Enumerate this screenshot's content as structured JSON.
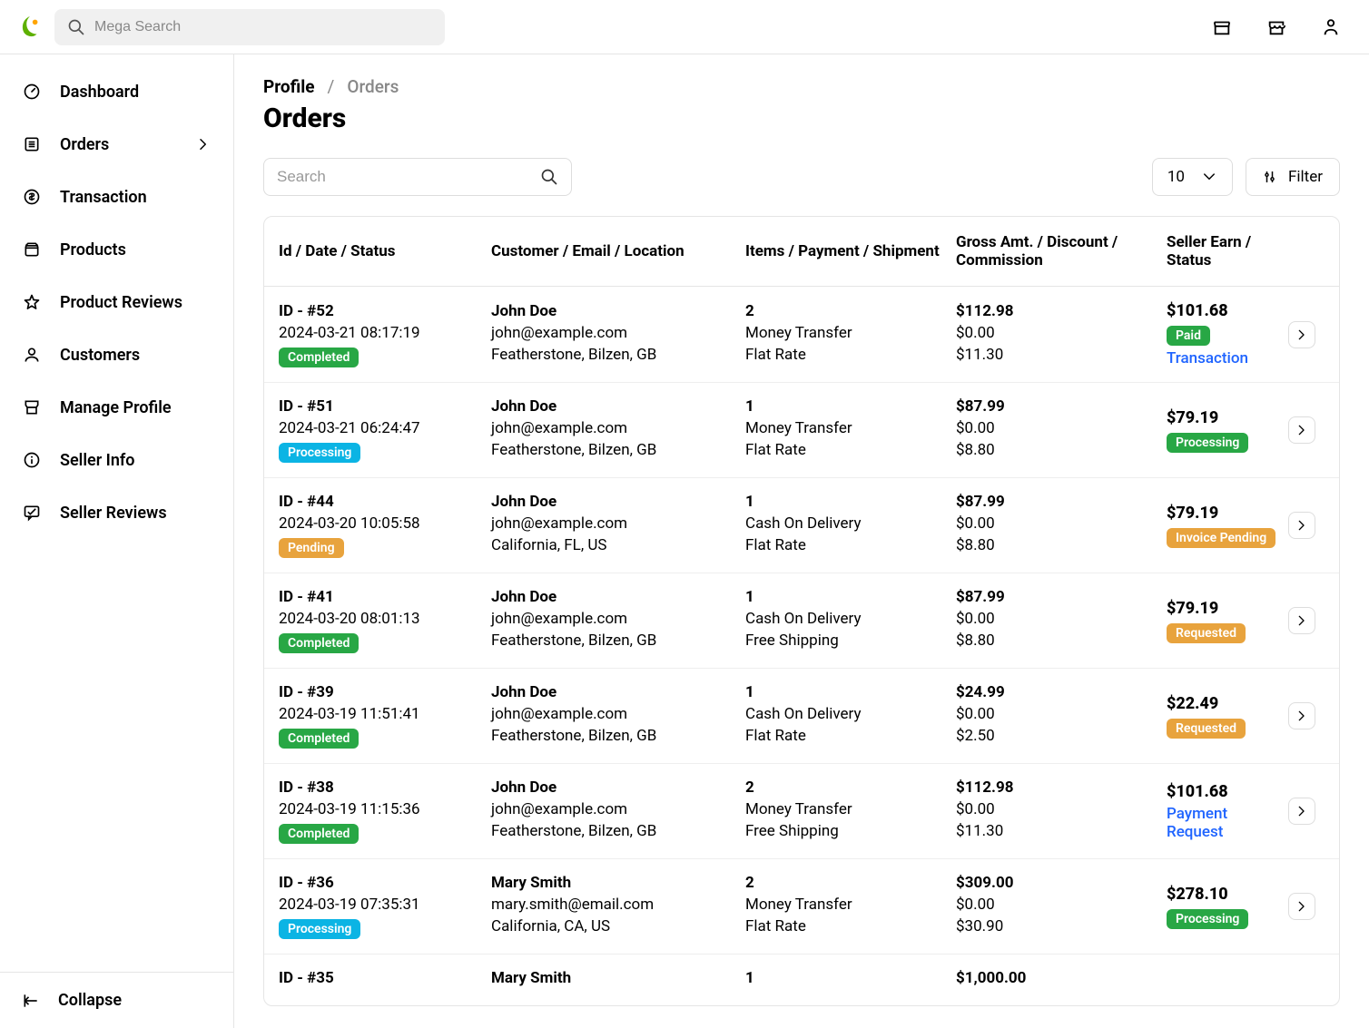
{
  "header": {
    "search_placeholder": "Mega Search"
  },
  "sidebar": {
    "items": [
      {
        "label": "Dashboard",
        "icon": "gauge"
      },
      {
        "label": "Orders",
        "icon": "list",
        "has_chev": true
      },
      {
        "label": "Transaction",
        "icon": "dollar"
      },
      {
        "label": "Products",
        "icon": "box"
      },
      {
        "label": "Product Reviews",
        "icon": "star"
      },
      {
        "label": "Customers",
        "icon": "user"
      },
      {
        "label": "Manage Profile",
        "icon": "store"
      },
      {
        "label": "Seller Info",
        "icon": "info"
      },
      {
        "label": "Seller Reviews",
        "icon": "chat"
      }
    ],
    "collapse_label": "Collapse"
  },
  "breadcrumb": {
    "root": "Profile",
    "current": "Orders",
    "sep": "/"
  },
  "page_title": "Orders",
  "toolbar": {
    "search_placeholder": "Search",
    "page_size": "10",
    "filter_label": "Filter"
  },
  "table": {
    "headers": {
      "c1": "Id / Date / Status",
      "c2": "Customer / Email / Location",
      "c3": "Items / Payment / Shipment",
      "c4": "Gross Amt. / Discount / Commission",
      "c5": "Seller Earn / Status"
    },
    "rows": [
      {
        "id": "ID - #52",
        "date": "2024-03-21 08:17:19",
        "status": "Completed",
        "status_class": "green",
        "name": "John Doe",
        "email": "john@example.com",
        "loc": "Featherstone, Bilzen, GB",
        "items": "2",
        "payment": "Money Transfer",
        "ship": "Flat Rate",
        "gross": "$112.98",
        "disc": "$0.00",
        "comm": "$11.30",
        "earn": "$101.68",
        "earn_status": "Paid",
        "earn_class": "green",
        "earn_link": "Transaction"
      },
      {
        "id": "ID - #51",
        "date": "2024-03-21 06:24:47",
        "status": "Processing",
        "status_class": "blue",
        "name": "John Doe",
        "email": "john@example.com",
        "loc": "Featherstone, Bilzen, GB",
        "items": "1",
        "payment": "Money Transfer",
        "ship": "Flat Rate",
        "gross": "$87.99",
        "disc": "$0.00",
        "comm": "$8.80",
        "earn": "$79.19",
        "earn_status": "Processing",
        "earn_class": "green"
      },
      {
        "id": "ID - #44",
        "date": "2024-03-20 10:05:58",
        "status": "Pending",
        "status_class": "orange",
        "name": "John Doe",
        "email": "john@example.com",
        "loc": "California, FL, US",
        "items": "1",
        "payment": "Cash On Delivery",
        "ship": "Flat Rate",
        "gross": "$87.99",
        "disc": "$0.00",
        "comm": "$8.80",
        "earn": "$79.19",
        "earn_status": "Invoice Pending",
        "earn_class": "orange"
      },
      {
        "id": "ID - #41",
        "date": "2024-03-20 08:01:13",
        "status": "Completed",
        "status_class": "green",
        "name": "John Doe",
        "email": "john@example.com",
        "loc": "Featherstone, Bilzen, GB",
        "items": "1",
        "payment": "Cash On Delivery",
        "ship": "Free Shipping",
        "gross": "$87.99",
        "disc": "$0.00",
        "comm": "$8.80",
        "earn": "$79.19",
        "earn_status": "Requested",
        "earn_class": "orange"
      },
      {
        "id": "ID - #39",
        "date": "2024-03-19 11:51:41",
        "status": "Completed",
        "status_class": "green",
        "name": "John Doe",
        "email": "john@example.com",
        "loc": "Featherstone, Bilzen, GB",
        "items": "1",
        "payment": "Cash On Delivery",
        "ship": "Flat Rate",
        "gross": "$24.99",
        "disc": "$0.00",
        "comm": "$2.50",
        "earn": "$22.49",
        "earn_status": "Requested",
        "earn_class": "orange"
      },
      {
        "id": "ID - #38",
        "date": "2024-03-19 11:15:36",
        "status": "Completed",
        "status_class": "green",
        "name": "John Doe",
        "email": "john@example.com",
        "loc": "Featherstone, Bilzen, GB",
        "items": "2",
        "payment": "Money Transfer",
        "ship": "Free Shipping",
        "gross": "$112.98",
        "disc": "$0.00",
        "comm": "$11.30",
        "earn": "$101.68",
        "earn_link": "Payment Request"
      },
      {
        "id": "ID - #36",
        "date": "2024-03-19 07:35:31",
        "status": "Processing",
        "status_class": "blue",
        "name": "Mary Smith",
        "email": "mary.smith@email.com",
        "loc": "California, CA, US",
        "items": "2",
        "payment": "Money Transfer",
        "ship": "Flat Rate",
        "gross": "$309.00",
        "disc": "$0.00",
        "comm": "$30.90",
        "earn": "$278.10",
        "earn_status": "Processing",
        "earn_class": "green"
      },
      {
        "id": "ID - #35",
        "date": "",
        "status": "",
        "status_class": "",
        "name": "Mary Smith",
        "email": "",
        "loc": "",
        "items": "1",
        "payment": "",
        "ship": "",
        "gross": "$1,000.00",
        "disc": "",
        "comm": "",
        "earn": "",
        "earn_status": "",
        "partial": true
      }
    ]
  }
}
